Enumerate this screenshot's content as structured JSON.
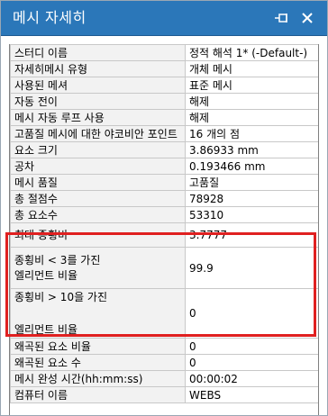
{
  "window": {
    "title": "메시 자세히",
    "pin_icon": "pin-icon",
    "close_icon": "close-icon",
    "accent": "#2b77b9",
    "highlight_color": "#e02020"
  },
  "rows": [
    {
      "label": "스터디 이름",
      "value": "정적 해석 1* (-Default-)"
    },
    {
      "label": "자세히메시 유형",
      "value": "개체 메시"
    },
    {
      "label": "사용된 메셔",
      "value": "표준 메시"
    },
    {
      "label": "자동 전이",
      "value": "해제"
    },
    {
      "label": "메시 자동 루프 사용",
      "value": "해제"
    },
    {
      "label": "고품질 메시에 대한 야코비안 포인트",
      "value": "16 개의 점"
    },
    {
      "label": "요소 크기",
      "value": "3.86933 mm"
    },
    {
      "label": "공차",
      "value": "0.193466 mm"
    },
    {
      "label": "메시 품질",
      "value": "고품질"
    },
    {
      "label": "총 절점수",
      "value": "78928"
    },
    {
      "label": "총 요소수",
      "value": "53310"
    },
    {
      "label": "최대 종횡비",
      "value": "3.7777"
    },
    {
      "label_line1": "종횡비 < 3를 가진",
      "label_line2": "엘리먼트 비율",
      "value": "99.9"
    },
    {
      "label_line1": "종횡비 > 10을 가진",
      "label_line2": "엘리먼트 비율",
      "value": "0"
    },
    {
      "label": "왜곡된 요소 비율",
      "value": "0"
    },
    {
      "label": "왜곡된 요소 수",
      "value": "0"
    },
    {
      "label": "메시 완성 시간(hh:mm:ss)",
      "value": "00:00:02"
    },
    {
      "label": "컴퓨터 이름",
      "value": "WEBS"
    }
  ]
}
